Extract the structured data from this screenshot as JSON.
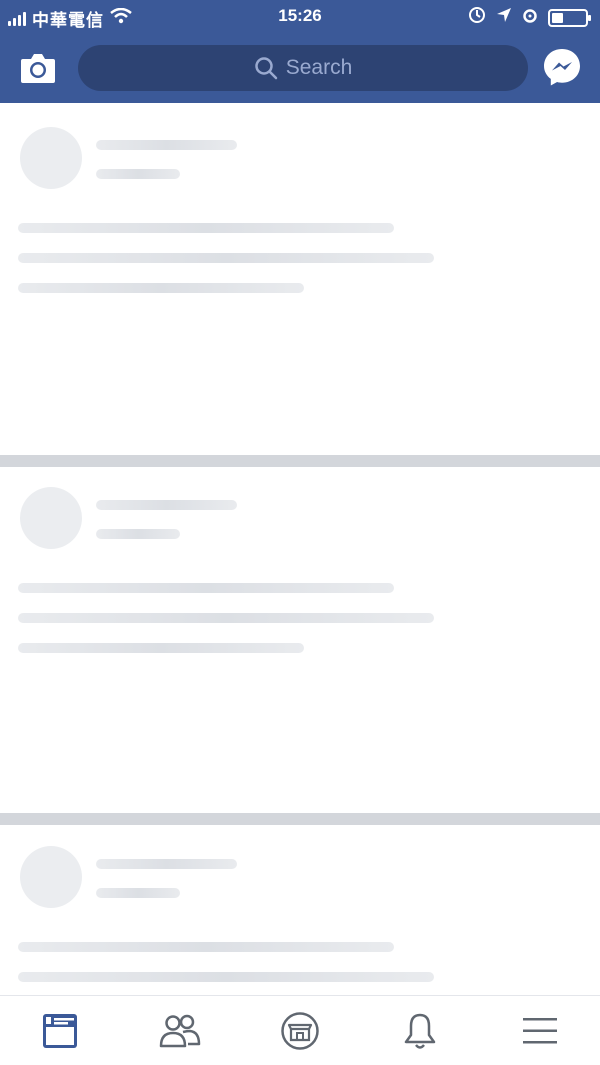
{
  "status_bar": {
    "carrier": "中華電信",
    "time": "15:26",
    "battery_level": 0.35
  },
  "header": {
    "search_placeholder": "Search",
    "camera_icon": "camera-icon",
    "messenger_icon": "messenger-icon"
  },
  "feed": {
    "state": "loading",
    "placeholder_posts": 3
  },
  "tabbar": {
    "tabs": [
      {
        "name": "news-feed",
        "icon": "news-feed-icon",
        "active": true
      },
      {
        "name": "friends",
        "icon": "friends-icon",
        "active": false
      },
      {
        "name": "marketplace",
        "icon": "marketplace-icon",
        "active": false
      },
      {
        "name": "notifications",
        "icon": "bell-icon",
        "active": false
      },
      {
        "name": "menu",
        "icon": "menu-icon",
        "active": false
      }
    ]
  },
  "colors": {
    "brand": "#3b5998",
    "search_bg": "#2d4373",
    "active_tab": "#3b5998",
    "inactive_tab": "#606770",
    "skeleton": "#e9ebee",
    "divider": "#d3d6db"
  }
}
